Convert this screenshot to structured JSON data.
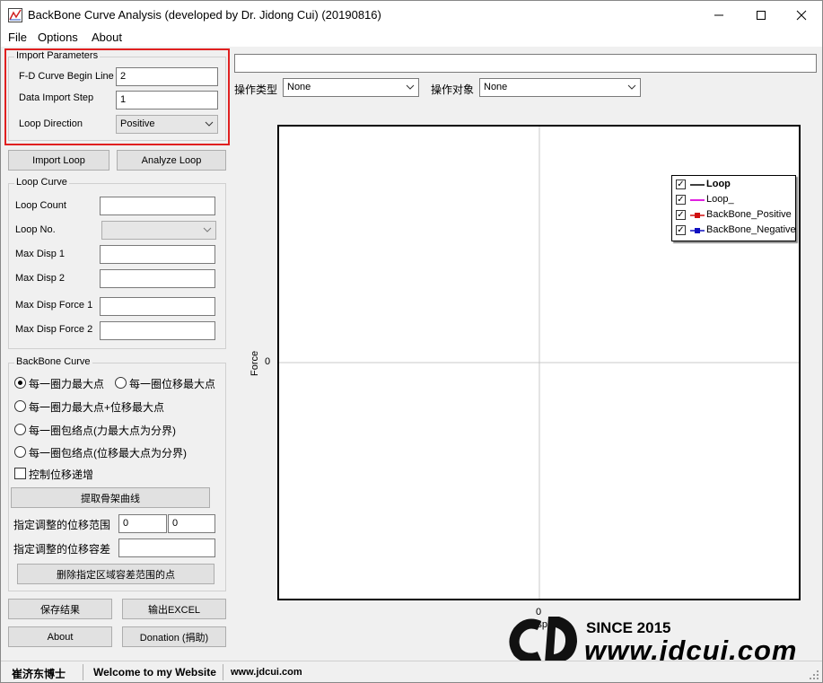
{
  "window": {
    "title": "BackBone Curve Analysis (developed by Dr. Jidong Cui) (20190816)"
  },
  "menu": [
    "File",
    "Options",
    "About"
  ],
  "import_params": {
    "title": "Import Parameters",
    "begin_line_label": "F-D Curve Begin Line",
    "begin_line_value": "2",
    "step_label": "Data Import Step",
    "step_value": "1",
    "direction_label": "Loop Direction",
    "direction_value": "Positive"
  },
  "buttons": {
    "import_loop": "Import Loop",
    "analyze_loop": "Analyze Loop",
    "extract_backbone": "提取骨架曲线",
    "delete_points": "删除指定区域容差范围的点",
    "save": "保存结果",
    "export_excel": "输出EXCEL",
    "about": "About",
    "donation": "Donation (捐助)"
  },
  "loop_curve": {
    "title": "Loop Curve",
    "count_label": "Loop Count",
    "no_label": "Loop No.",
    "max_disp1_label": "Max Disp 1",
    "max_disp2_label": "Max Disp 2",
    "max_force1_label": "Max Disp Force 1",
    "max_force2_label": "Max Disp Force 2"
  },
  "backbone_curve": {
    "title": "BackBone Curve",
    "opt1": "每一圈力最大点",
    "opt2": "每一圈位移最大点",
    "opt3": "每一圈力最大点+位移最大点",
    "opt4": "每一圈包络点(力最大点为分界)",
    "opt5": "每一圈包络点(位移最大点为分界)",
    "check_label": "控制位移递增",
    "range_label": "指定调整的位移范围",
    "range_from": "0",
    "range_to": "0",
    "tolerance_label": "指定调整的位移容差"
  },
  "toolbar": {
    "op_type_label": "操作类型",
    "op_type_value": "None",
    "op_target_label": "操作对象",
    "op_target_value": "None"
  },
  "chart": {
    "ylabel": "Force",
    "xlabel": "Disp",
    "x_tick": "0",
    "y_tick": "0",
    "legend": [
      "Loop",
      "Loop_",
      "BackBone_Positive",
      "BackBone_Negative"
    ],
    "colors": {
      "loop": "#000000",
      "loop_": "#e020e0",
      "positive": "#d01010",
      "negative": "#1010c0"
    }
  },
  "chart_data": {
    "type": "line",
    "x_tick": "0",
    "y_tick": "0",
    "xlabel": "Disp",
    "ylabel": "Force",
    "series": [
      {
        "name": "Loop",
        "values": []
      },
      {
        "name": "Loop_",
        "values": []
      },
      {
        "name": "BackBone_Positive",
        "values": []
      },
      {
        "name": "BackBone_Negative",
        "values": []
      }
    ],
    "legend": "top-right",
    "grid": true
  },
  "status": {
    "author": "崔济东博士",
    "welcome": "Welcome to my Website",
    "url": "www.jdcui.com"
  },
  "watermark": {
    "since": "SINCE 2015",
    "site": "www.jdcui.com"
  }
}
